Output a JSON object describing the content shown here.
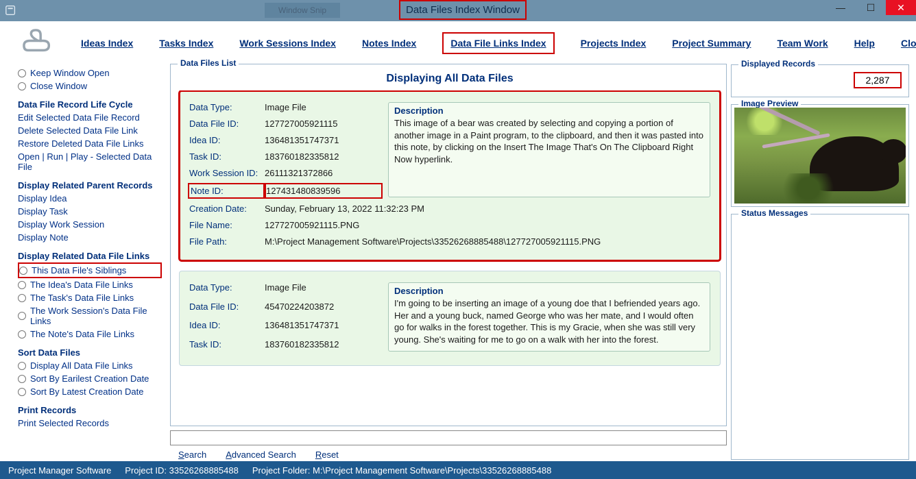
{
  "window": {
    "title": "Data Files Index Window",
    "ghost_button": "Window Snip"
  },
  "toolbar": {
    "items": [
      {
        "label": "Ideas Index"
      },
      {
        "label": "Tasks Index"
      },
      {
        "label": "Work Sessions Index"
      },
      {
        "label": "Notes Index"
      },
      {
        "label": "Data File Links Index",
        "hot": true
      },
      {
        "label": "Projects Index"
      },
      {
        "label": "Project Summary"
      },
      {
        "label": "Team Work"
      },
      {
        "label": "Help"
      },
      {
        "label": "Close Program"
      }
    ]
  },
  "left_panel": {
    "keep_open": "Keep Window Open",
    "close_window": "Close Window",
    "sec_life": "Data File Record Life Cycle",
    "life": [
      "Edit Selected Data File Record",
      "Delete Selected Data File Link",
      "Restore Deleted Data File Links",
      "Open | Run | Play - Selected Data File"
    ],
    "sec_parent": "Display Related Parent Records",
    "parent": [
      "Display Idea",
      "Display Task",
      "Display Work Session",
      "Display Note"
    ],
    "sec_links": "Display Related Data File Links",
    "links": [
      "This Data File's Siblings",
      "The Idea's Data File Links",
      "The Task's Data File Links",
      "The Work Session's Data File Links",
      "The Note's Data File Links"
    ],
    "sec_sort": "Sort Data Files",
    "sort": [
      "Display All Data File Links",
      "Sort By Earilest Creation Date",
      "Sort By Latest Creation Date"
    ],
    "sec_print": "Print Records",
    "print": [
      "Print Selected Records"
    ]
  },
  "center": {
    "group_title": "Data Files List",
    "header": "Displaying All Data Files",
    "records": [
      {
        "labels": {
          "data_type": "Data Type:",
          "data_file_id": "Data File ID:",
          "idea_id": "Idea ID:",
          "task_id": "Task ID:",
          "ws_id": "Work Session ID:",
          "note_id": "Note ID:",
          "cdate": "Creation Date:",
          "fname": "File Name:",
          "fpath": "File Path:",
          "desc": "Description"
        },
        "data_type": "Image File",
        "data_file_id": "127727005921115",
        "idea_id": "136481351747371",
        "task_id": "183760182335812",
        "ws_id": "26111321372866",
        "note_id": "127431480839596",
        "cdate": "Sunday, February 13, 2022   11:32:23 PM",
        "fname": "127727005921115.PNG",
        "fpath": "M:\\Project Management Software\\Projects\\33526268885488\\127727005921115.PNG",
        "desc": "This image of a bear was created by selecting and copying a portion of another image in a Paint program, to the clipboard, and then it was pasted into this note, by clicking on the Insert The Image That's On The Clipboard Right Now hyperlink."
      },
      {
        "labels": {
          "data_type": "Data Type:",
          "data_file_id": "Data File ID:",
          "idea_id": "Idea ID:",
          "task_id": "Task ID:",
          "desc": "Description"
        },
        "data_type": "Image File",
        "data_file_id": "45470224203872",
        "idea_id": "136481351747371",
        "task_id": "183760182335812",
        "desc": "I'm going to be inserting an image of a young doe that I befriended years ago. Her and a young buck, named George who was her mate, and I would often go for walks in the forest together. This is my Gracie, when she was still very young. She's waiting for me to go on a walk with her into the forest."
      }
    ],
    "search_links": {
      "search": "Search",
      "advanced": "Advanced Search",
      "reset": "Reset"
    }
  },
  "right_panel": {
    "displayed_records_label": "Displayed Records",
    "displayed_records": "2,287",
    "image_preview_label": "Image Preview",
    "status_label": "Status Messages"
  },
  "footer": {
    "app": "Project Manager Software",
    "project_id_label": "Project ID:",
    "project_id": "33526268885488",
    "project_folder_label": "Project Folder:",
    "project_folder": "M:\\Project Management Software\\Projects\\33526268885488"
  }
}
